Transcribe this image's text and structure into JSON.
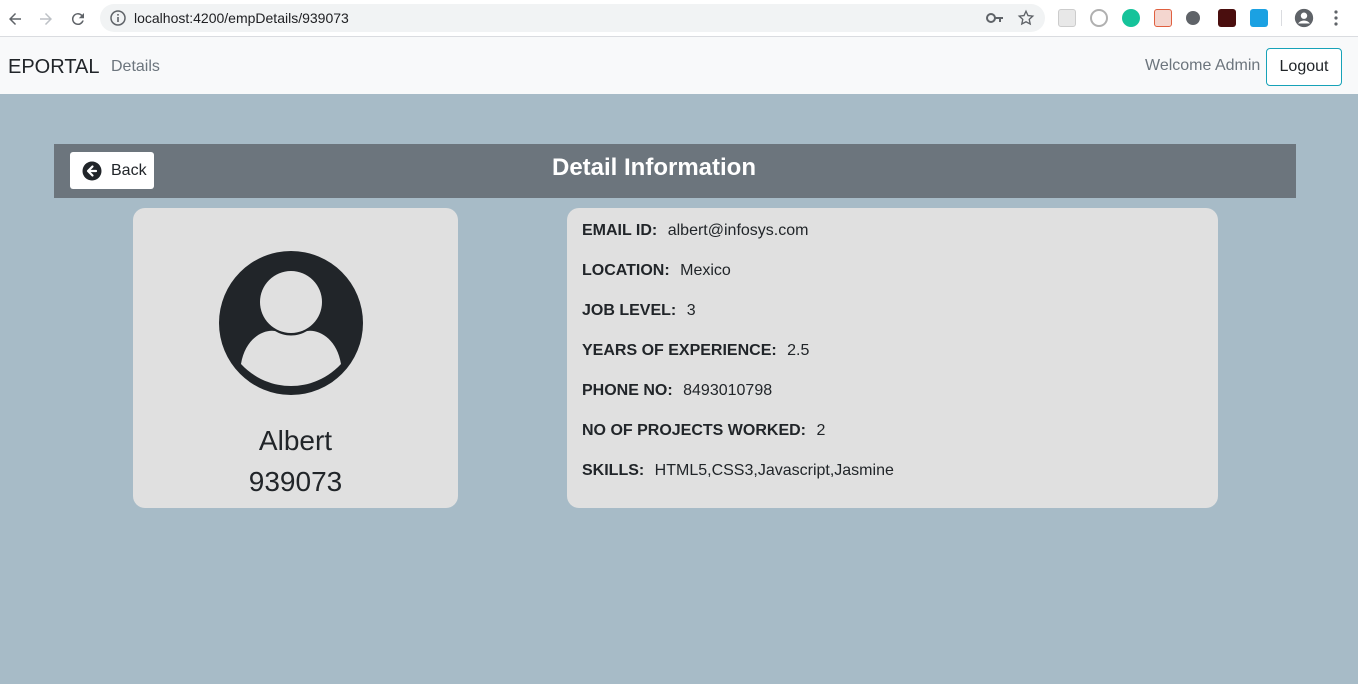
{
  "browser": {
    "url": "localhost:4200/empDetails/939073"
  },
  "navbar": {
    "brand": "EPORTAL",
    "details_link": "Details",
    "welcome_text": "Welcome Admin",
    "logout_label": "Logout"
  },
  "header": {
    "back_label": "Back",
    "title": "Detail Information"
  },
  "profile": {
    "name": "Albert",
    "employee_id": "939073"
  },
  "details": [
    {
      "label": "EMAIL ID:",
      "value": "albert@infosys.com"
    },
    {
      "label": "LOCATION:",
      "value": "Mexico"
    },
    {
      "label": "JOB LEVEL:",
      "value": "3"
    },
    {
      "label": "YEARS OF EXPERIENCE:",
      "value": "2.5"
    },
    {
      "label": "PHONE NO:",
      "value": "8493010798"
    },
    {
      "label": "NO OF PROJECTS WORKED:",
      "value": "2"
    },
    {
      "label": "SKILLS:",
      "value": "HTML5,CSS3,Javascript,Jasmine"
    }
  ],
  "colors": {
    "page_background": "#a7bbc7",
    "header_band": "#6c757d",
    "card_background": "#e0e0e0",
    "logout_border": "#17a2b8"
  },
  "icons": {
    "back": "arrow-circle-left-icon",
    "avatar": "user-circle-icon"
  }
}
